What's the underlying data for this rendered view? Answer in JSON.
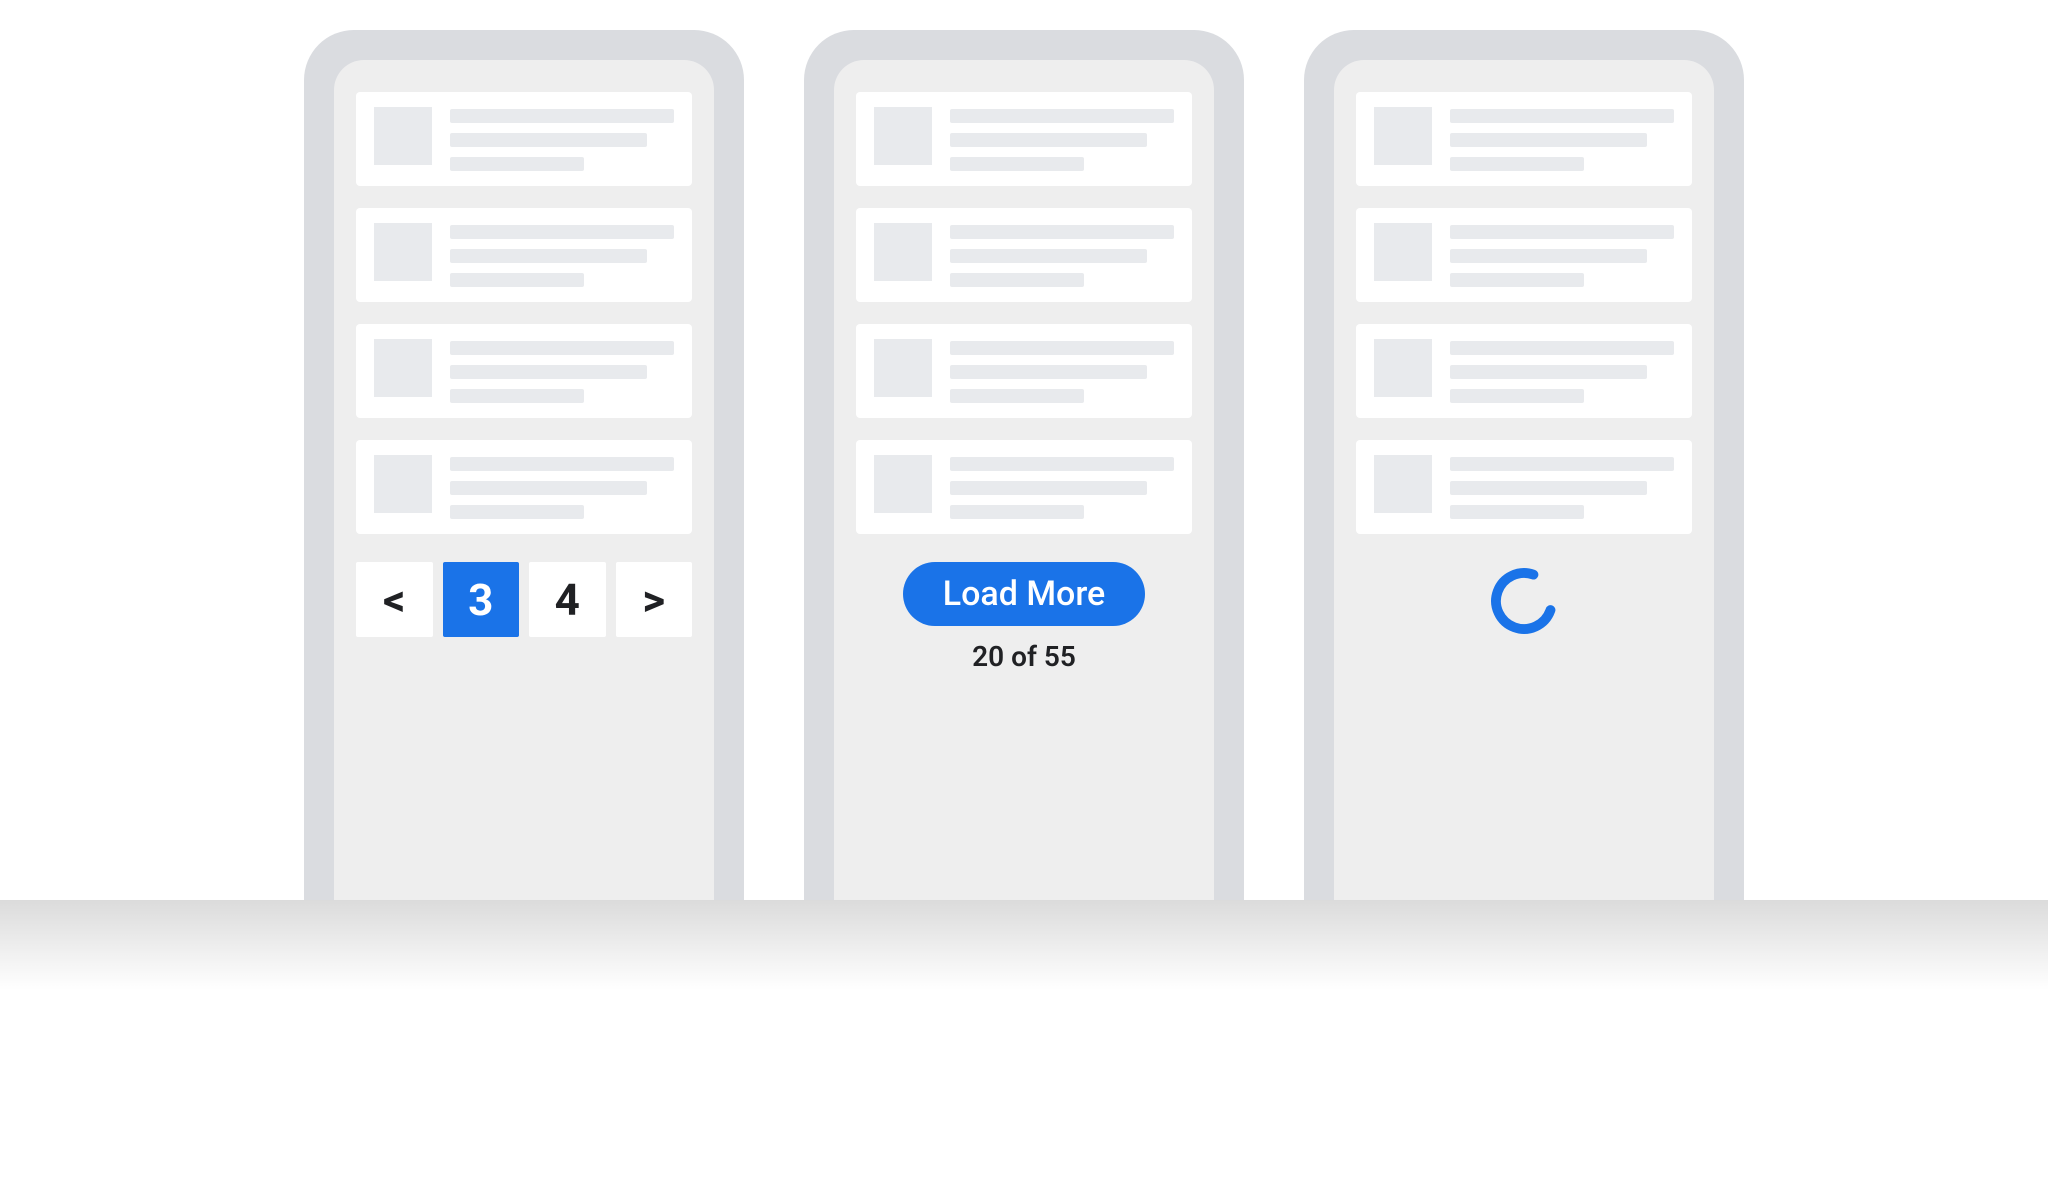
{
  "colors": {
    "accent": "#1a73e8",
    "placeholder": "#e8eaed",
    "device": "#dadce0",
    "screen": "#eeeeee"
  },
  "pagination": {
    "prev_glyph": "<",
    "next_glyph": ">",
    "pages": [
      "3",
      "4"
    ],
    "current_page": "3"
  },
  "loadmore": {
    "button_label": "Load More",
    "count_text": "20 of 55"
  },
  "infinite": {
    "spinner_label": "loading"
  }
}
